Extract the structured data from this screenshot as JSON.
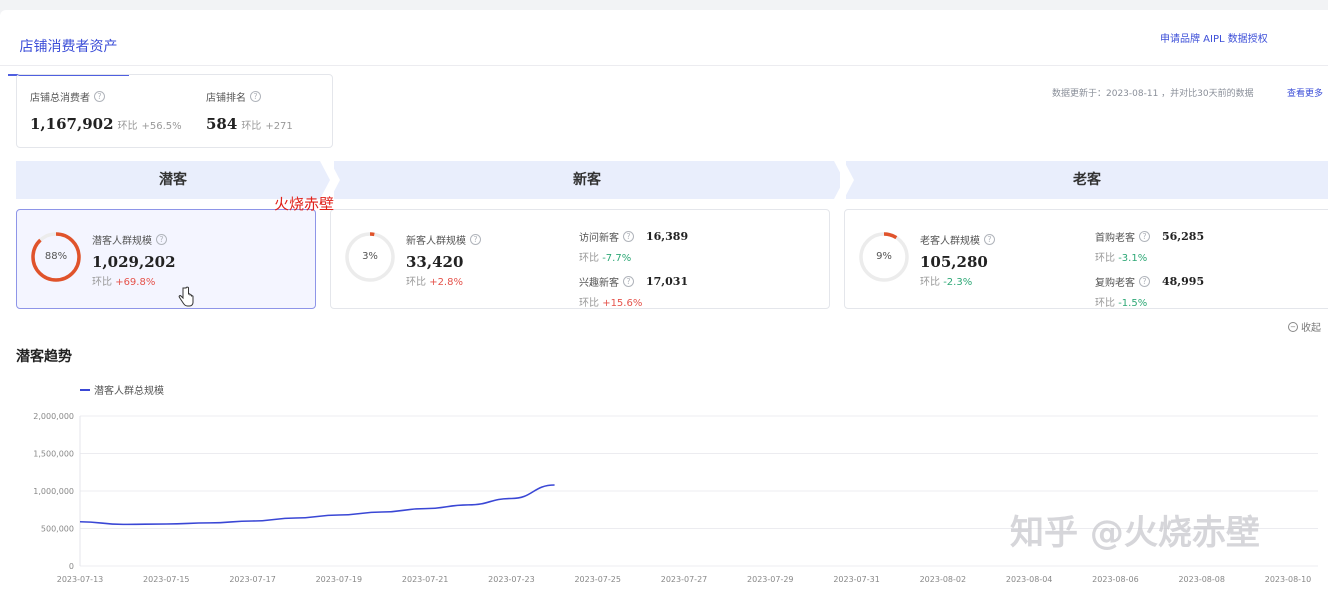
{
  "header": {
    "tab_label": "店铺消费者资产",
    "apply_link": "申请品牌 AIPL 数据授权",
    "update_text": "数据更新于：2023-08-11 ，并对比30天前的数据",
    "update_more": "查看更多"
  },
  "summary": [
    {
      "label": "店铺总消费者",
      "value": "1,167,902",
      "cmp_label": "环比",
      "cmp_value": "+56.5%"
    },
    {
      "label": "店铺排名",
      "value": "584",
      "cmp_label": "环比",
      "cmp_value": "+271"
    }
  ],
  "stages": [
    "潜客",
    "新客",
    "老客"
  ],
  "segments": {
    "potential": {
      "percent": "88%",
      "percent_value": 88,
      "label": "潜客人群规模",
      "value": "1,029,202",
      "cmp_label": "环比",
      "cmp_value": "+69.8%"
    },
    "new": {
      "percent": "3%",
      "percent_value": 3,
      "label": "新客人群规模",
      "value": "33,420",
      "cmp_label": "环比",
      "cmp_value": "+2.8%",
      "subs": [
        {
          "label": "访问新客",
          "value": "16,389",
          "cmp_label": "环比",
          "cmp_value": "-7.7%"
        },
        {
          "label": "兴趣新客",
          "value": "17,031",
          "cmp_label": "环比",
          "cmp_value": "+15.6%"
        }
      ]
    },
    "old": {
      "percent": "9%",
      "percent_value": 9,
      "label": "老客人群规模",
      "value": "105,280",
      "cmp_label": "环比",
      "cmp_value": "-2.3%",
      "subs": [
        {
          "label": "首购老客",
          "value": "56,285",
          "cmp_label": "环比",
          "cmp_value": "-3.1%"
        },
        {
          "label": "复购老客",
          "value": "48,995",
          "cmp_label": "环比",
          "cmp_value": "-1.5%"
        }
      ]
    }
  },
  "overlay_text": "火烧赤壁",
  "collapse_label": "收起",
  "trend": {
    "title": "潜客趋势"
  },
  "watermark": "知乎 @火烧赤壁",
  "colors": {
    "accent": "#3d4fd8",
    "ring": "#e0532b",
    "up": "#e5534b",
    "down": "#2ea876"
  },
  "chart_data": {
    "type": "line",
    "title": "",
    "xlabel": "",
    "ylabel": "",
    "ylim": [
      0,
      2000000
    ],
    "yticks": [
      "2,000,000",
      "1,500,000",
      "1,000,000",
      "500,000",
      "0"
    ],
    "ytick_values": [
      2000000,
      1500000,
      1000000,
      500000,
      0
    ],
    "xticks": [
      "2023-07-13",
      "2023-07-15",
      "2023-07-17",
      "2023-07-19",
      "2023-07-21",
      "2023-07-23",
      "2023-07-25",
      "2023-07-27",
      "2023-07-29",
      "2023-07-31",
      "2023-08-02",
      "2023-08-04",
      "2023-08-06",
      "2023-08-08",
      "2023-08-10"
    ],
    "x": [
      "2023-07-13",
      "2023-07-14",
      "2023-07-15",
      "2023-07-16",
      "2023-07-17",
      "2023-07-18",
      "2023-07-19",
      "2023-07-20",
      "2023-07-21",
      "2023-07-22",
      "2023-07-23",
      "2023-07-24"
    ],
    "series": [
      {
        "name": "潜客人群总规模",
        "values": [
          590000,
          555000,
          560000,
          575000,
          600000,
          640000,
          680000,
          720000,
          765000,
          815000,
          900000,
          1080000
        ]
      }
    ],
    "legend": "top-left",
    "grid": true
  }
}
